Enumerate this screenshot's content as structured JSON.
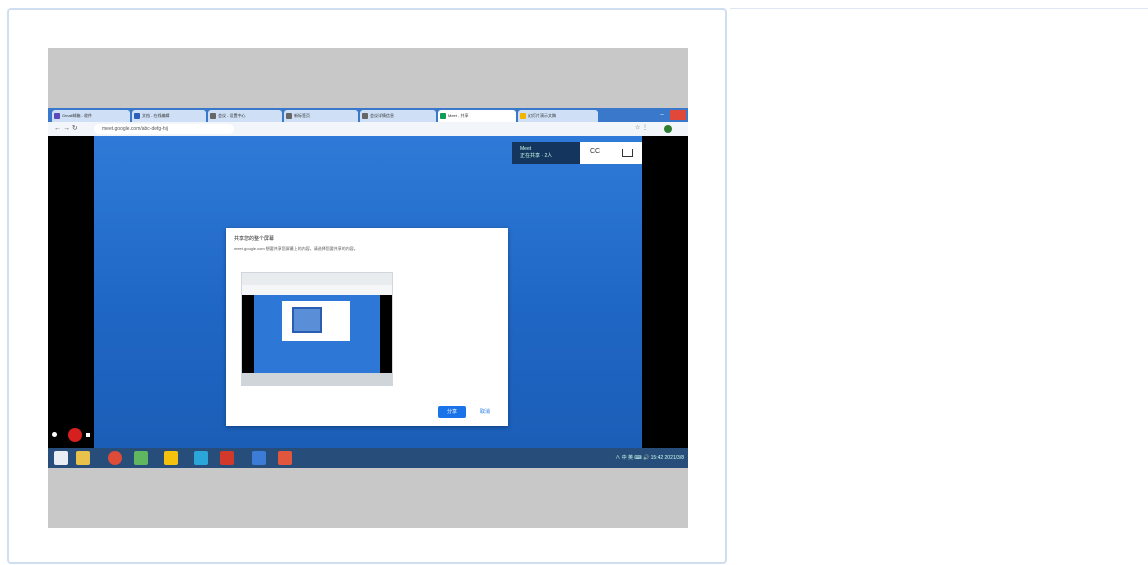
{
  "browser": {
    "tabs": [
      {
        "label": "Gmail邮箱 - 收件"
      },
      {
        "label": "文档 - 在线编辑"
      },
      {
        "label": "会议 - 设置中心"
      },
      {
        "label": "新标签页"
      },
      {
        "label": "会议详情信息"
      },
      {
        "label": "Meet - 共享"
      },
      {
        "label": "幻灯片演示文稿"
      }
    ],
    "url": "meet.google.com/abc-defg-hij",
    "nav_glyphs": "← → ↻",
    "menu_glyphs": "☆ ⋮"
  },
  "meeting_bar": {
    "label_line1": "Meet",
    "label_line2": "正在共享 · 2人",
    "captions_glyph": "CC",
    "present_glyph": "▭"
  },
  "dialog": {
    "title": "共享您的整个屏幕",
    "subtitle": "meet.google.com 想要共享您屏幕上的内容。请选择您要共享的内容。",
    "share_label": "分享",
    "cancel_label": "取消"
  },
  "taskbar": {
    "tray_text": "∧ 中 英 ⌨ 🔊 15:42 2021/3/8"
  },
  "colors": {
    "browser_accent": "#3a78cc",
    "desktop_blue": "#2f7ad8",
    "share_button": "#1a73e8",
    "record_red": "#d62020"
  }
}
